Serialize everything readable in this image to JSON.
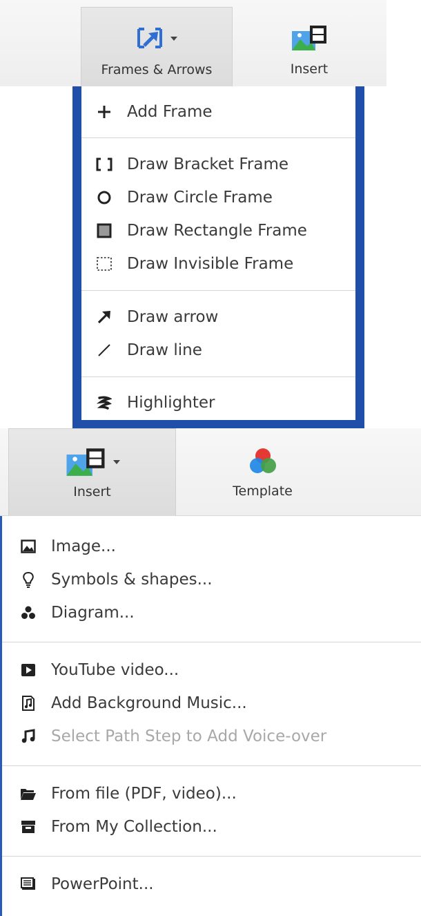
{
  "top": {
    "toolbar": {
      "frames_label": "Frames & Arrows",
      "insert_label": "Insert"
    },
    "menu": {
      "add_frame": "Add Frame",
      "bracket": "Draw Bracket Frame",
      "circle": "Draw Circle Frame",
      "rectangle": "Draw Rectangle Frame",
      "invisible": "Draw Invisible Frame",
      "arrow": "Draw arrow",
      "line": "Draw line",
      "highlighter": "Highlighter"
    }
  },
  "bottom": {
    "toolbar": {
      "insert_label": "Insert",
      "template_label": "Template"
    },
    "menu": {
      "image": "Image...",
      "symbols": "Symbols & shapes...",
      "diagram": "Diagram...",
      "youtube": "YouTube video...",
      "music": "Add Background Music...",
      "voiceover": "Select Path Step to Add Voice-over",
      "from_file": "From file (PDF, video)...",
      "collection": "From My Collection...",
      "powerpoint": "PowerPoint..."
    }
  },
  "icons": {
    "frames": "frames-arrow-icon",
    "insert": "insert-media-icon",
    "template": "template-color-icon",
    "add": "plus-icon",
    "bracket": "bracket-icon",
    "circle": "circle-icon",
    "rectangle": "rectangle-icon",
    "invisible": "dashed-rectangle-icon",
    "arrow": "arrow-icon",
    "line": "line-icon",
    "highlighter": "highlighter-icon",
    "image": "image-icon",
    "symbols": "lightbulb-icon",
    "diagram": "diagram-icon",
    "youtube": "play-icon",
    "music": "music-file-icon",
    "voiceover": "music-note-icon",
    "folder": "folder-icon",
    "collection": "archive-icon",
    "powerpoint": "presentation-icon"
  },
  "colors": {
    "menu_border": "#1f4fa8",
    "text": "#3a3a3a",
    "disabled_text": "#a8a8a8",
    "accent_blue": "#2f6fd3"
  }
}
